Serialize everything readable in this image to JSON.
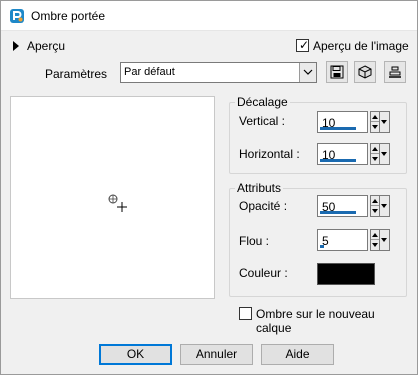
{
  "window": {
    "title": "Ombre portée"
  },
  "preview_section": {
    "label": "Aperçu",
    "checkbox_label": "Aperçu de l'image",
    "checked": true
  },
  "presets": {
    "label": "Paramètres",
    "value": "Par défaut"
  },
  "offset_group": {
    "title": "Décalage",
    "vertical_label": "Vertical :",
    "vertical_value": "10",
    "horizontal_label": "Horizontal :",
    "horizontal_value": "10"
  },
  "attributes_group": {
    "title": "Attributs",
    "opacity_label": "Opacité :",
    "opacity_value": "50",
    "blur_label": "Flou :",
    "blur_value": "5",
    "color_label": "Couleur :",
    "color_value": "#000000"
  },
  "new_layer": {
    "label": "Ombre sur le nouveau calque",
    "checked": false
  },
  "buttons": {
    "ok": "OK",
    "cancel": "Annuler",
    "help": "Aide"
  },
  "colors": {
    "accent": "#1a6ab0",
    "default_border": "#0078d7"
  }
}
